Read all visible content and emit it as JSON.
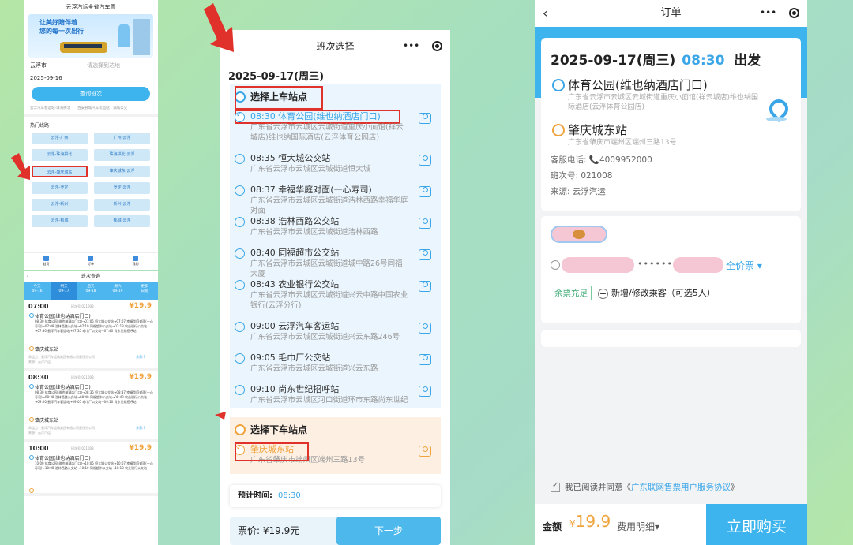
{
  "p1": {
    "title": "云浮汽运全省汽车票",
    "banner1": "让美好陪伴着",
    "banner2": "您的每一次出行",
    "from": "云浮市",
    "to_placeholder": "请选择到达地",
    "date": "2025-09-16",
    "query": "查询班次",
    "mini": "云浮汽车客运站-珠海拱北　　古安县城汽车客运站　满城公交",
    "hot": "热门线路",
    "routes": [
      "云浮-广州",
      "广州-云浮",
      "云浮-珠海拱北",
      "珠海拱北-云浮",
      "云浮-肇庆城东",
      "肇庆城东-云浮",
      "云浮-罗定",
      "罗定-云浮",
      "云浮-新兴",
      "新兴-云浮",
      "云浮-郁城",
      "郁城-云浮"
    ],
    "tabs": [
      "首页",
      "订单",
      "我的"
    ]
  },
  "p2": {
    "title": "班次查询",
    "dates": [
      [
        "今天",
        "09-16"
      ],
      [
        "明天",
        "09-17"
      ],
      [
        "后天",
        "09-18"
      ],
      [
        "周六",
        "09-19"
      ],
      [
        "更多",
        "日期"
      ]
    ],
    "trips": [
      {
        "time": "07:00",
        "code": "班次号:021003",
        "price": "¥19.9",
        "start": "体育公园(维也纳酒店门口)",
        "via": "08:30 体育公园(维也纳酒店门口)→07:05 恒大城公交站→07:07 幸福华庭对面(一心寿司)→07:08 浩林西路公交站→07:10 同福超市公交站→07:13 农业银行公交站→07:30 云浮汽车客运站→07:35 毛巾厂公交站→07:40 尚东世纪招呼站",
        "end": "肇庆城东站",
        "ft": "承运方：云浮汽车运输集团有限公司云浮分公司",
        "ft2": "来源：云浮汽运",
        "ft3": "余票:7"
      },
      {
        "time": "08:30",
        "code": "班次号:021008",
        "price": "¥19.9",
        "start": "体育公园(维也纳酒店门口)",
        "via": "08:30 体育公园(维也纳酒店门口)→08:35 恒大城公交站→08:37 幸福华庭对面(一心寿司)→08:38 浩林西路公交站→08:40 同福超市公交站→08:43 农业银行公交站→09:00 云浮汽车客运站→09:05 毛巾厂公交站→09:10 尚东世纪招呼站",
        "end": "肇庆城东站",
        "ft": "承运方：云浮汽车运输集团有限公司云浮分公司",
        "ft2": "来源：云浮汽运",
        "ft3": "余票:7"
      },
      {
        "time": "10:00",
        "code": "班次号:021003",
        "price": "¥19.9",
        "start": "体育公园(维也纳酒店门口)",
        "via": "10:00 体育公园(维也纳酒店门口)→10:05 恒大城公交站→10:07 幸福华庭对面(一心寿司)→10:08 浩林西路公交站→10:10 同福超市公交站→10:13 农业银行公交站",
        "end": "",
        "ft": "",
        "ft2": "",
        "ft3": ""
      }
    ]
  },
  "p3": {
    "title": "班次选择",
    "date": "2025-09-17(周三)",
    "up_title": "选择上车站点",
    "stops": [
      {
        "name": "08:30 体育公园(维也纳酒店门口)",
        "addr": "广东省云浮市云城区云城街道重庆小面馆(祥云城店)维也纳国际酒店(云浮体育公园店)"
      },
      {
        "name": "08:35 恒大城公交站",
        "addr": "广东省云浮市云城区云城街道恒大城"
      },
      {
        "name": "08:37 幸福华庭对面(一心寿司)",
        "addr": "广东省云浮市云城区云城街道浩林西路幸福华庭对面"
      },
      {
        "name": "08:38 浩林西路公交站",
        "addr": "广东省云浮市云城区云城街道浩林西路"
      },
      {
        "name": "08:40 同福超市公交站",
        "addr": "广东省云浮市云城区云城街道城中路26号同福大厦"
      },
      {
        "name": "08:43 农业银行公交站",
        "addr": "广东省云浮市云城区云城街道兴云中路中国农业银行(云浮分行)"
      },
      {
        "name": "09:00 云浮汽车客运站",
        "addr": "广东省云浮市云城区云城街道兴云东路246号"
      },
      {
        "name": "09:05 毛巾厂公交站",
        "addr": "广东省云浮市云城区云城街道兴云东路"
      },
      {
        "name": "09:10 尚东世纪招呼站",
        "addr": "广东省云浮市云城区河口街道环市东路尚东世纪"
      }
    ],
    "down_title": "选择下车站点",
    "down_stop": "肇庆城东站",
    "down_addr": "广东省肇庆市端州区端州三路13号",
    "eta_label": "预计时间:",
    "eta": "08:30",
    "fare": "票价: ¥19.9元",
    "next": "下一步"
  },
  "p4": {
    "title": "订单",
    "date": "2025-09-17(周三)",
    "time": "08:30",
    "dep": "出发",
    "start": "体育公园(维也纳酒店门口)",
    "start_addr": "广东省云浮市云城区云城街道重庆小面馆(祥云城店)维也纳国际酒店(云浮体育公园店)",
    "end": "肇庆城东站",
    "end_addr": "广东省肇庆市端州区端州三路13号",
    "phone": "客服电话: 📞4009952000",
    "code": "班次号: 021008",
    "source": "来源: 云浮汽运",
    "dots": "••••••",
    "fare_type": "全价票 ▾",
    "balance": "余票充足",
    "add": "新增/修改乘客（可选5人）",
    "agree": "我已阅读并同意《",
    "agree_link": "广东联网售票用户服务协议",
    "agree_end": "》",
    "amount_label": "金额",
    "amount": "19.9",
    "cur": "¥",
    "detail": "费用明细▾",
    "buy": "立即购买"
  },
  "colors": {
    "accent": "#3db4ed",
    "orange": "#f0a23b",
    "red": "#e0312a"
  }
}
